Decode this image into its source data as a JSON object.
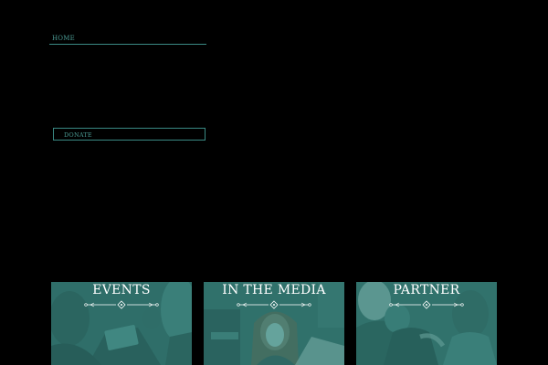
{
  "nav": {
    "home_label": "HOME",
    "donate_label": "DONATE"
  },
  "tiles": [
    {
      "title": "EVENTS",
      "icon": "ornament-divider"
    },
    {
      "title": "IN THE MEDIA",
      "icon": "ornament-divider"
    },
    {
      "title": "PARTNER",
      "icon": "ornament-divider"
    }
  ],
  "colors": {
    "background": "#000000",
    "accent": "#3a8a84",
    "tile_tint": "#36807a",
    "tile_text": "#ffffff"
  }
}
